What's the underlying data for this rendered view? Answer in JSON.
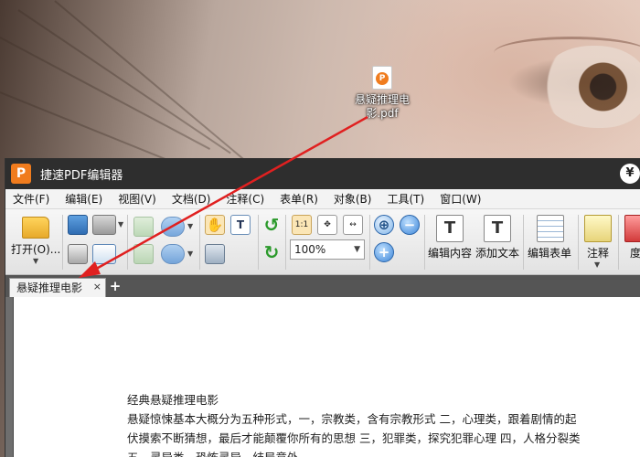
{
  "desktop": {
    "file_icon": "pdf-file-icon",
    "file_name_line1": "悬疑推理电",
    "file_name_line2": "影.pdf"
  },
  "window": {
    "logo_letter": "P",
    "title": "捷速PDF编辑器",
    "control_glyph": "¥"
  },
  "menu": [
    "文件(F)",
    "编辑(E)",
    "视图(V)",
    "文档(D)",
    "注释(C)",
    "表单(R)",
    "对象(B)",
    "工具(T)",
    "窗口(W)"
  ],
  "toolbar": {
    "open_label": "打开(O)...",
    "zoom_value": "100%",
    "page_view_glyph": "1:1",
    "edit_content_label": "编辑内容",
    "add_text_label": "添加文本",
    "edit_form_label": "编辑表单",
    "comment_label": "注释",
    "partial_label": "度"
  },
  "tabs": {
    "active_tab": "悬疑推理电影",
    "close_glyph": "×",
    "add_glyph": "+"
  },
  "document": {
    "lines": [
      "经典悬疑推理电影",
      "悬疑惊悚基本大概分为五种形式，一，宗教类，含有宗教形式 二，心理类，跟着剧情的起",
      "伏摸索不断猜想，最后才能颠覆你所有的思想 三，犯罪类，探究犯罪心理 四，人格分裂类",
      "五，灵异类，恐怖灵异，结局意外"
    ]
  },
  "colors": {
    "accent": "#f07c1e",
    "annotation": "#e02020",
    "titlebar": "#2e2e2e"
  }
}
